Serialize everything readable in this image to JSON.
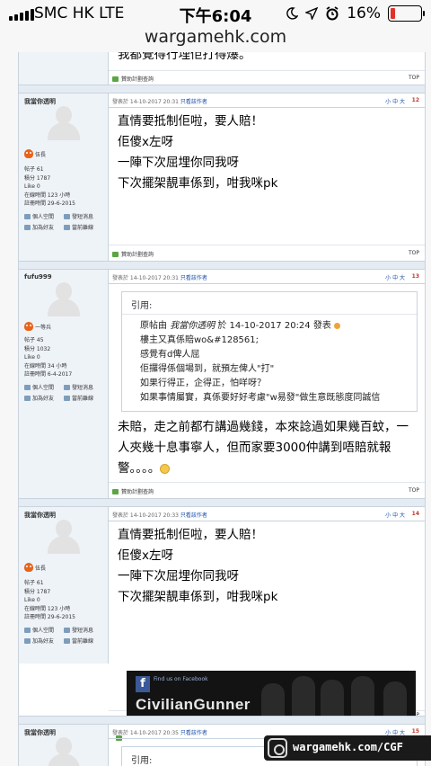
{
  "status_bar": {
    "carrier": "SMC HK   LTE",
    "time": "下午6:04",
    "battery": "16%",
    "battery_level": 0.16,
    "icons": [
      "moon-icon",
      "location-arrow-icon",
      "alarm-clock-icon"
    ]
  },
  "url": "wargamehk.com",
  "top_post": {
    "text": "我都覺得行埋佢打得爆。",
    "ad_link": "贊助計劃查詢",
    "top_label": "TOP"
  },
  "post1": {
    "username": "我當你透明",
    "rank": "伍長",
    "stats": [
      "帖子 61",
      "積分 1787",
      "Like 0",
      "在線時間 123 小時",
      "註冊時間 29-6-2015"
    ],
    "links": [
      "個人空間",
      "發短消息",
      "加為好友",
      "當前離線"
    ],
    "posted": "發表於 14-10-2017 20:31",
    "only_author": "只看該作者",
    "size_labels": "小 中 大",
    "floor": "12",
    "lines": [
      "直情要抵制佢啦，要人賠！",
      "佢傻x左呀",
      "一陣下次屈埋你同我呀",
      "下次擺架靚車係到，咁我咪pk"
    ],
    "ad_link": "贊助計劃查詢",
    "top_label": "TOP"
  },
  "post2": {
    "username": "fufu999",
    "rank": "一等兵",
    "stats": [
      "帖子 45",
      "積分 1032",
      "Like 0",
      "在線時間 34 小時",
      "註冊時間 6-4-2017"
    ],
    "links": [
      "個人空間",
      "發短消息",
      "加為好友",
      "當前離線"
    ],
    "posted": "發表於 14-10-2017 20:31",
    "only_author": "只看該作者",
    "size_labels": "小 中 大",
    "floor": "13",
    "quote": {
      "label": "引用:",
      "header_prefix": "原帖由 ",
      "header_author": "我當你透明",
      "header_suffix": " 於 14-10-2017 20:24 發表",
      "lines": [
        "樓主又真係賠wo&#128561;",
        "感覺有d俾人屈",
        "佢攞得係個場到，就預左俾人\"打\"",
        "如果行得正，企得正，怕咩呀？",
        "如果事情屬實，真係要好好考慮\"w易發\"做生意既態度同誠信"
      ]
    },
    "body": "未賠，走之前都冇講過幾錢，本來諗過如果幾百蚊，一人夾幾十息事寧人，但而家要3000仲講到唔賠就報警。。。。",
    "ad_link": "贊助計劃查詢",
    "top_label": "TOP"
  },
  "post3": {
    "username": "我當你透明",
    "rank": "伍長",
    "stats": [
      "帖子 61",
      "積分 1787",
      "Like 0",
      "在線時間 123 小時",
      "註冊時間 29-6-2015"
    ],
    "links": [
      "個人空間",
      "發短消息",
      "加為好友",
      "當前離線"
    ],
    "posted": "發表於 14-10-2017 20:33",
    "only_author": "只看該作者",
    "size_labels": "小 中 大",
    "floor": "14",
    "lines": [
      "直情要抵制佢啦，要人賠！",
      "佢傻x左呀",
      "一陣下次屈埋你同我呀",
      "下次擺架靚車係到，咁我咪pk"
    ],
    "top_label": "TOP",
    "banner": {
      "find_us": "Find us on Facebook",
      "brand": "CivilianGunner"
    }
  },
  "post4": {
    "username": "我當你透明",
    "posted": "發表於 14-10-2017 20:35",
    "only_author": "只看該作者",
    "size_labels": "小 中 大",
    "floor": "15",
    "quote_label": "引用:"
  },
  "watermark": "wargamehk.com/CGF"
}
